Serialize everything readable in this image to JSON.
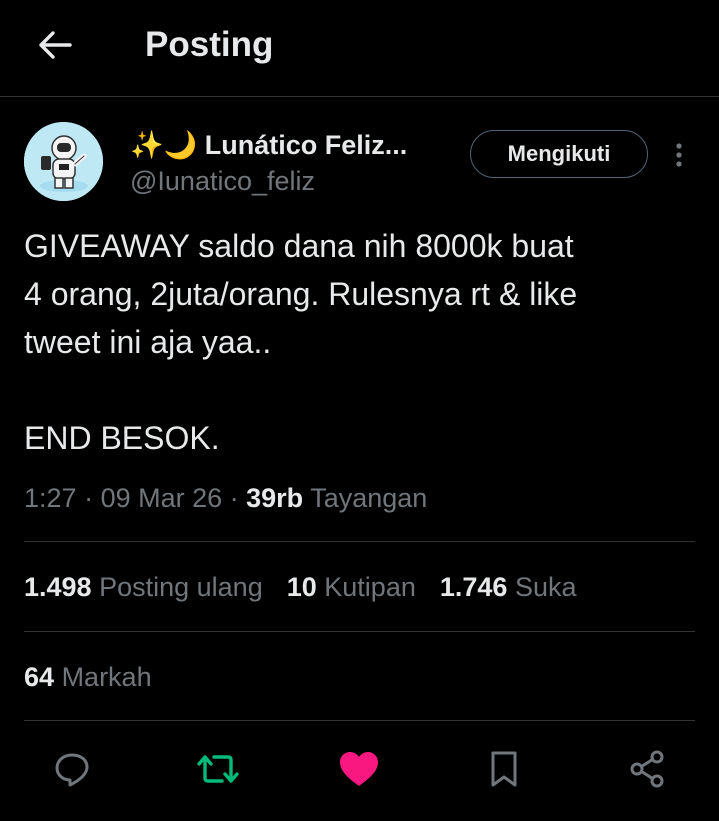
{
  "header": {
    "title": "Posting",
    "back_icon": "arrow-left-icon"
  },
  "author": {
    "display_name": "Lunático Feliz...",
    "emoji": "✨🌙",
    "handle": "@Iunatico_feliz",
    "follow_label": "Mengikuti"
  },
  "tweet": {
    "text": "GIVEAWAY saldo dana nih 8000k buat\n4 orang, 2juta/orang. Rulesnya rt & like\ntweet ini aja yaa..\n\nEND BESOK.",
    "time": "1:27",
    "sep1": " · ",
    "date": "09 Mar 26",
    "sep2": " · ",
    "views_count": "39rb",
    "views_label": "Tayangan"
  },
  "stats": {
    "reposts_count": "1.498",
    "reposts_label": "Posting ulang",
    "quotes_count": "10",
    "quotes_label": "Kutipan",
    "likes_count": "1.746",
    "likes_label": "Suka",
    "bookmarks_count": "64",
    "bookmarks_label": "Markah"
  },
  "actions": {
    "reply_icon": "reply-icon",
    "repost_icon": "repost-icon",
    "like_icon": "heart-icon",
    "bookmark_icon": "bookmark-icon",
    "share_icon": "share-icon"
  },
  "colors": {
    "background": "#000000",
    "text_primary": "#e7e9ea",
    "text_secondary": "#71767b",
    "divider": "#2f3336",
    "repost_active": "#00ba7c",
    "like_active": "#f91880"
  }
}
